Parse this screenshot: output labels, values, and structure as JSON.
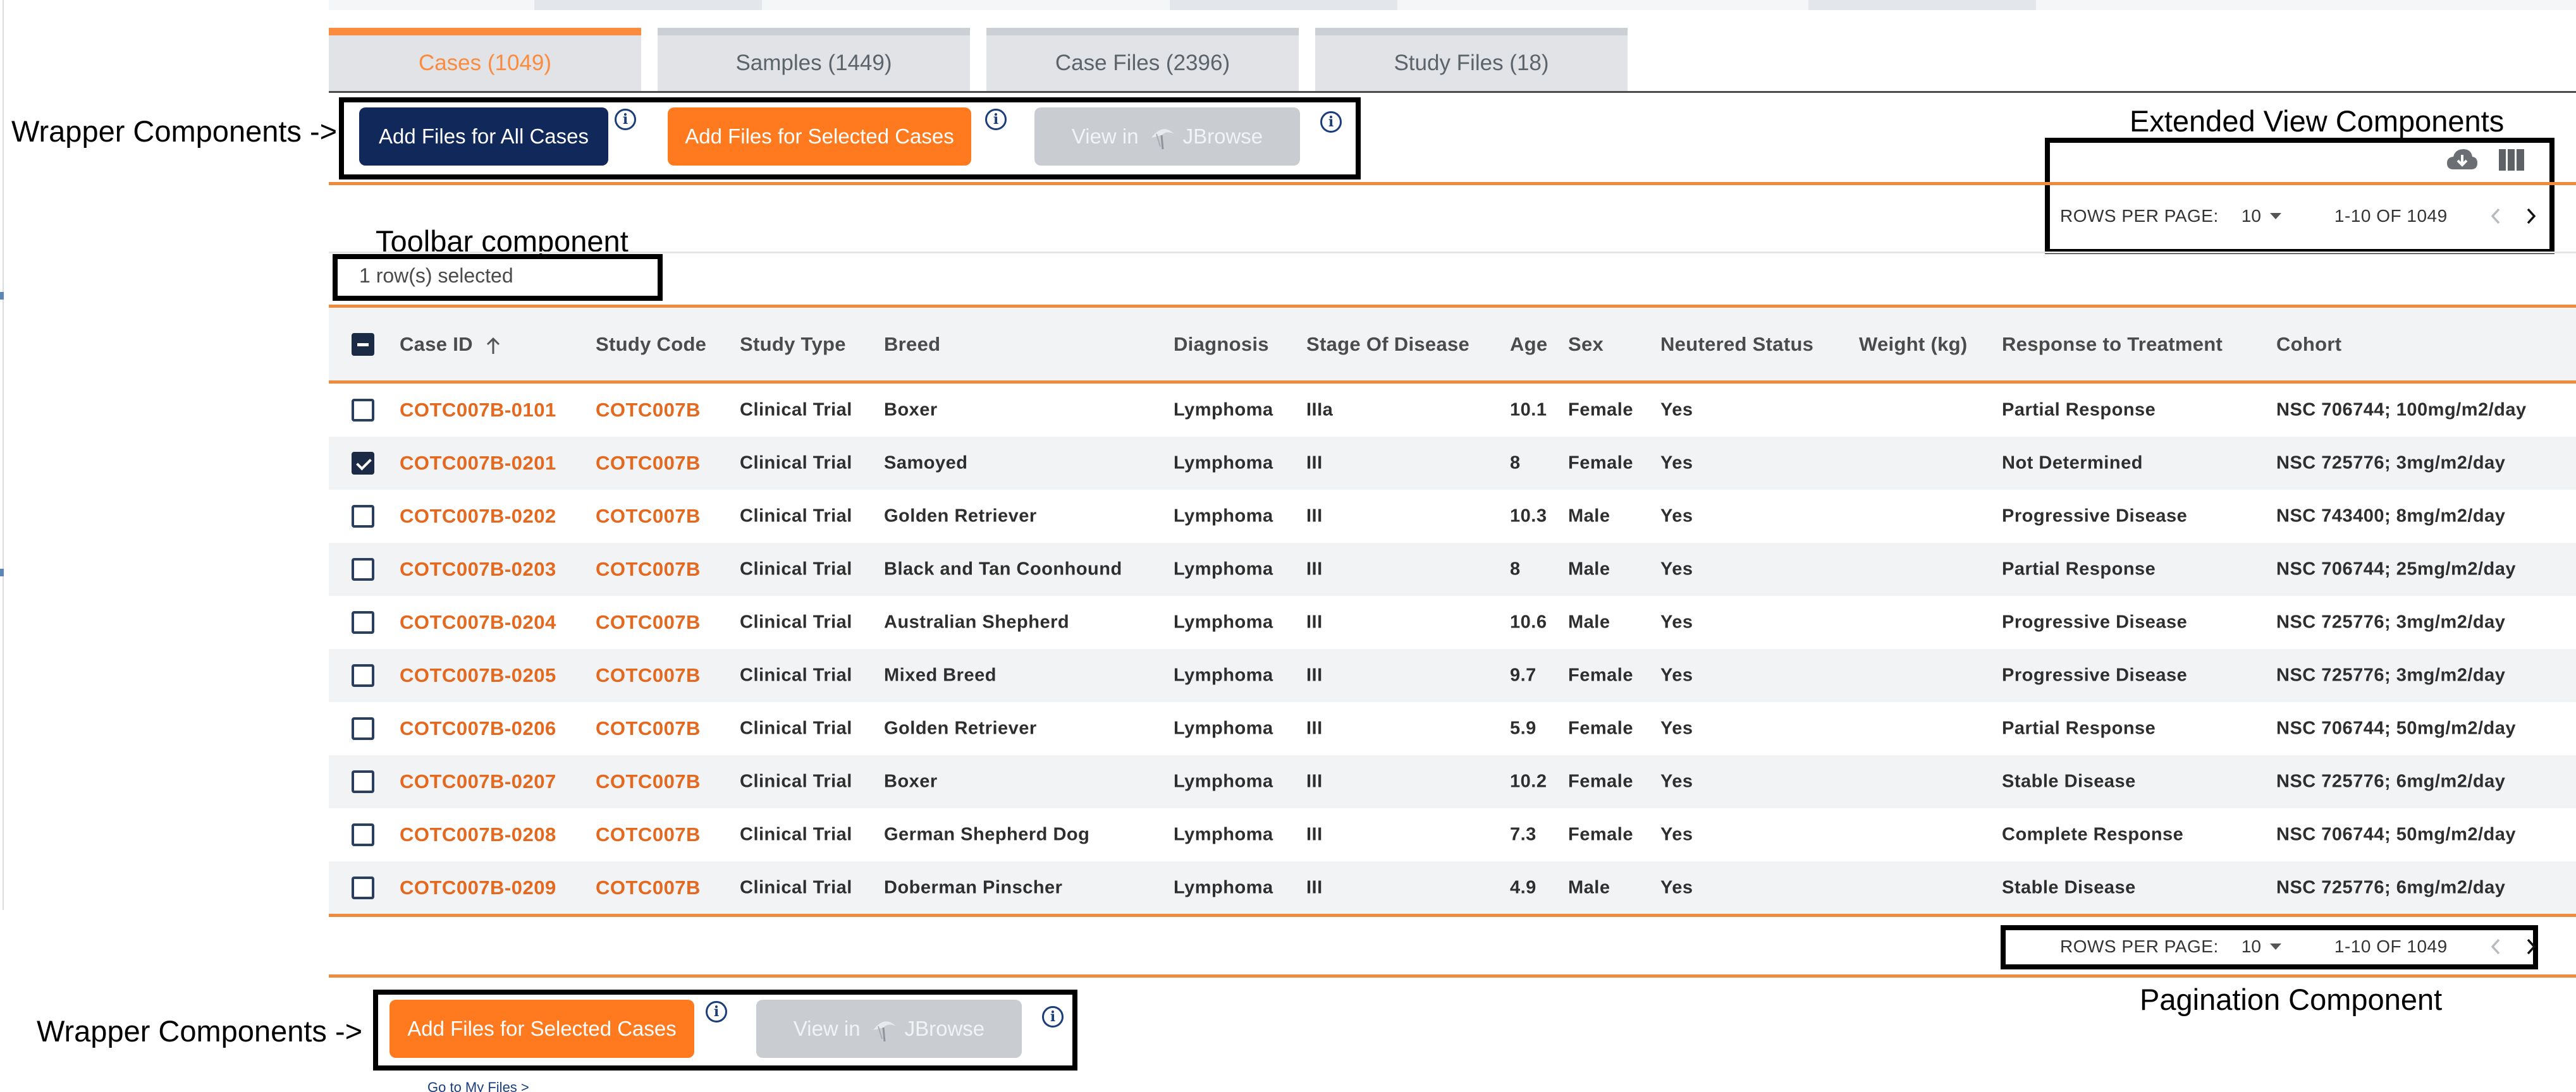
{
  "tabs": [
    {
      "label": "Cases (1049)",
      "active": true
    },
    {
      "label": "Samples (1449)",
      "active": false
    },
    {
      "label": "Case Files (2396)",
      "active": false
    },
    {
      "label": "Study Files (18)",
      "active": false
    }
  ],
  "annotations": {
    "wrapper_top": "Wrapper Components ->",
    "extended_view": "Extended View Components",
    "toolbar": "Toolbar component",
    "wrapper_bottom": "Wrapper Components ->",
    "pagination": "Pagination Component"
  },
  "wrapper_top": {
    "add_all_label": "Add Files for All Cases",
    "add_selected_label": "Add Files for Selected Cases",
    "view_in_label": "View in",
    "jbrowse_label": "JBrowse"
  },
  "wrapper_bottom": {
    "add_selected_label": "Add Files for Selected Cases",
    "view_in_label": "View in",
    "jbrowse_label": "JBrowse",
    "goto_label": "Go to My Files >"
  },
  "icons": {
    "info": "info-circle-icon",
    "download": "cloud-download-icon",
    "columns": "view-columns-icon",
    "jbrowse": "jbrowse-logo-icon"
  },
  "colors": {
    "accent_orange": "#ff7a1e",
    "link_orange": "#e4681e",
    "navy": "#10285a"
  },
  "pagination_top": {
    "label": "ROWS PER PAGE:",
    "value": "10",
    "range": "1-10 OF 1049"
  },
  "pagination_bottom": {
    "label": "ROWS PER PAGE:",
    "value": "10",
    "range": "1-10 OF 1049"
  },
  "toolbar": {
    "selected_text": "1 row(s) selected"
  },
  "table": {
    "columns": [
      "Case ID",
      "Study Code",
      "Study Type",
      "Breed",
      "Diagnosis",
      "Stage Of Disease",
      "Age",
      "Sex",
      "Neutered Status",
      "Weight (kg)",
      "Response to Treatment",
      "Cohort"
    ],
    "rows": [
      {
        "selected": false,
        "cells": [
          "COTC007B-0101",
          "COTC007B",
          "Clinical Trial",
          "Boxer",
          "Lymphoma",
          "IIIa",
          "10.1",
          "Female",
          "Yes",
          "",
          "Partial Response",
          "NSC 706744; 100mg/m2/day"
        ]
      },
      {
        "selected": true,
        "cells": [
          "COTC007B-0201",
          "COTC007B",
          "Clinical Trial",
          "Samoyed",
          "Lymphoma",
          "III",
          "8",
          "Female",
          "Yes",
          "",
          "Not Determined",
          "NSC 725776; 3mg/m2/day"
        ]
      },
      {
        "selected": false,
        "cells": [
          "COTC007B-0202",
          "COTC007B",
          "Clinical Trial",
          "Golden Retriever",
          "Lymphoma",
          "III",
          "10.3",
          "Male",
          "Yes",
          "",
          "Progressive Disease",
          "NSC 743400; 8mg/m2/day"
        ]
      },
      {
        "selected": false,
        "cells": [
          "COTC007B-0203",
          "COTC007B",
          "Clinical Trial",
          "Black and Tan Coonhound",
          "Lymphoma",
          "III",
          "8",
          "Male",
          "Yes",
          "",
          "Partial Response",
          "NSC 706744; 25mg/m2/day"
        ]
      },
      {
        "selected": false,
        "cells": [
          "COTC007B-0204",
          "COTC007B",
          "Clinical Trial",
          "Australian Shepherd",
          "Lymphoma",
          "III",
          "10.6",
          "Male",
          "Yes",
          "",
          "Progressive Disease",
          "NSC 725776; 3mg/m2/day"
        ]
      },
      {
        "selected": false,
        "cells": [
          "COTC007B-0205",
          "COTC007B",
          "Clinical Trial",
          "Mixed Breed",
          "Lymphoma",
          "III",
          "9.7",
          "Female",
          "Yes",
          "",
          "Progressive Disease",
          "NSC 725776; 3mg/m2/day"
        ]
      },
      {
        "selected": false,
        "cells": [
          "COTC007B-0206",
          "COTC007B",
          "Clinical Trial",
          "Golden Retriever",
          "Lymphoma",
          "III",
          "5.9",
          "Female",
          "Yes",
          "",
          "Partial Response",
          "NSC 706744; 50mg/m2/day"
        ]
      },
      {
        "selected": false,
        "cells": [
          "COTC007B-0207",
          "COTC007B",
          "Clinical Trial",
          "Boxer",
          "Lymphoma",
          "III",
          "10.2",
          "Female",
          "Yes",
          "",
          "Stable Disease",
          "NSC 725776; 6mg/m2/day"
        ]
      },
      {
        "selected": false,
        "cells": [
          "COTC007B-0208",
          "COTC007B",
          "Clinical Trial",
          "German Shepherd Dog",
          "Lymphoma",
          "III",
          "7.3",
          "Female",
          "Yes",
          "",
          "Complete Response",
          "NSC 706744; 50mg/m2/day"
        ]
      },
      {
        "selected": false,
        "cells": [
          "COTC007B-0209",
          "COTC007B",
          "Clinical Trial",
          "Doberman Pinscher",
          "Lymphoma",
          "III",
          "4.9",
          "Male",
          "Yes",
          "",
          "Stable Disease",
          "NSC 725776; 6mg/m2/day"
        ]
      }
    ]
  }
}
